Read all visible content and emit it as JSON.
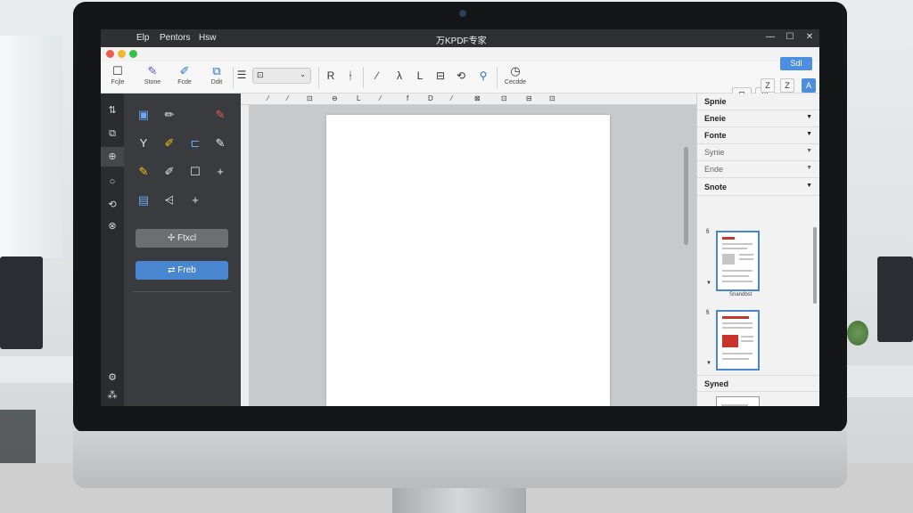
{
  "titlebar": {
    "menus": [
      "Elp",
      "Pentors",
      "Hsw"
    ],
    "app_title": "万KPDF专家",
    "controls": [
      "—",
      "☐",
      "✕"
    ]
  },
  "toolbar": {
    "buttons": [
      {
        "label": "Fcjle",
        "icon": "☐"
      },
      {
        "label": "Stone",
        "icon": "✎"
      },
      {
        "label": "Fcde",
        "icon": "✐"
      },
      {
        "label": "Ddit",
        "icon": "⧉"
      }
    ],
    "zoom_value": "⊡",
    "format_icons": [
      "R",
      "ᛂ",
      "⁄",
      "λ",
      "L",
      "⊟",
      "⟲",
      "⚲"
    ],
    "undo_label": "Cecdde",
    "right_buttons": [
      "⊟",
      "⊞"
    ],
    "send_label": "Sdl",
    "view_buttons": [
      "Z",
      "Z",
      "A"
    ]
  },
  "rail": {
    "icons": [
      "⇅",
      "⧉",
      "⊕",
      "○",
      "⟲",
      "⊗",
      "⚙",
      "⁂"
    ]
  },
  "tools": {
    "button_gray": "Ftxcl",
    "button_blue": "Freb"
  },
  "ruler": {
    "marks": [
      "⁄",
      "⁄",
      "⊡",
      "⊖",
      "L",
      "⁄",
      "f",
      "D",
      "⁄",
      "⊠",
      "⊡",
      "⊟",
      "⊡"
    ]
  },
  "right_panel": {
    "sections": [
      {
        "label": "Spnie",
        "expanded": false
      },
      {
        "label": "Eneie",
        "expanded": false
      },
      {
        "label": "Fonte",
        "expanded": false
      },
      {
        "label": "Synie",
        "expanded": false
      },
      {
        "label": "Ende",
        "expanded": false
      },
      {
        "label": "Snote",
        "expanded": true
      }
    ],
    "thumbnails": [
      {
        "label": "fi",
        "caption": "Snandbst"
      },
      {
        "label": "fi",
        "caption": ""
      }
    ],
    "synced_label": "Syned"
  }
}
